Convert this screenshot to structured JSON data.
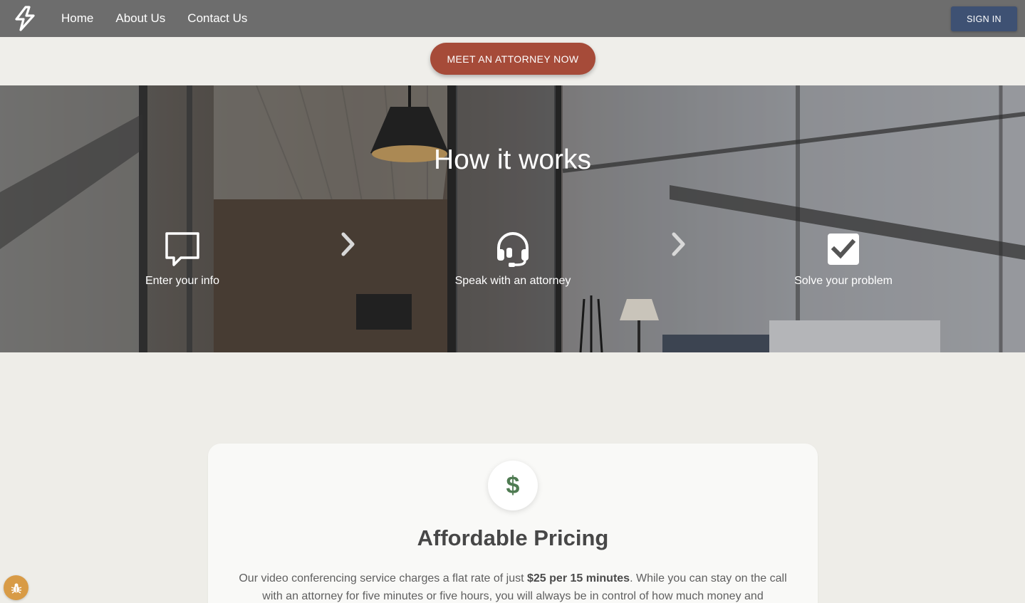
{
  "nav": {
    "links": [
      "Home",
      "About Us",
      "Contact Us"
    ],
    "signin_label": "SIGN IN",
    "logo_icon": "lightning-bolt-icon",
    "background_color": "#6d6d6d",
    "signin_color": "#3e5173"
  },
  "cta": {
    "label": "MEET AN ATTORNEY NOW",
    "color": "#a64b39"
  },
  "hero": {
    "title": "How it works",
    "steps": [
      {
        "label": "Enter your info",
        "icon": "speech-bubble-icon"
      },
      {
        "label": "Speak with an attorney",
        "icon": "headset-icon"
      },
      {
        "label": "Solve your problem",
        "icon": "checkbox-icon"
      }
    ],
    "separator_icon": "chevron-right-icon"
  },
  "pricing": {
    "icon_symbol": "$",
    "icon": "dollar-icon",
    "title": "Affordable Pricing",
    "text_before": "Our video conferencing service charges a flat rate of just ",
    "text_bold": "$25 per 15 minutes",
    "text_after": ". While you can stay on the call with an attorney for five minutes or five hours, you will always be in control of how much money and",
    "accent_color": "#4f7b52"
  },
  "floating": {
    "icon": "bug-icon",
    "color": "#d89b46"
  }
}
